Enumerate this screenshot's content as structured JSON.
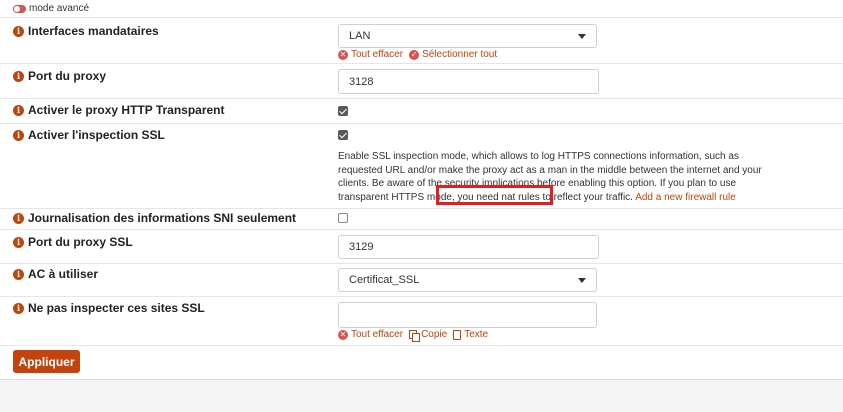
{
  "mode_toggle": {
    "label": "mode avancé"
  },
  "fields": {
    "interfaces": {
      "label": "Interfaces mandataires",
      "value": "LAN",
      "clear_all": "Tout effacer",
      "select_all": "Sélectionner tout"
    },
    "proxy_port": {
      "label": "Port du proxy",
      "value": "3128"
    },
    "transparent": {
      "label": "Activer le proxy HTTP Transparent",
      "checked": true
    },
    "ssl_inspection": {
      "label": "Activer l'inspection SSL",
      "checked": true,
      "help_text": "Enable SSL inspection mode, which allows to log HTTPS connections information, such as requested URL and/or make the proxy act as a man in the middle between the internet and your clients. Be aware of the security implications before enabling this option. If you plan to use transparent HTTPS mode, you need nat rules to reflect your traffic.",
      "help_link": "Add a new firewall rule"
    },
    "sni_logging": {
      "label": "Journalisation des informations SNI seulement",
      "checked": false
    },
    "ssl_port": {
      "label": "Port du proxy SSL",
      "value": "3129"
    },
    "ca": {
      "label": "AC à utiliser",
      "value": "Certificat_SSL"
    },
    "no_inspect": {
      "label": "Ne pas inspecter ces sites SSL",
      "value": "",
      "clear_all": "Tout effacer",
      "copy": "Copie",
      "text": "Texte"
    }
  },
  "apply_button": "Appliquer",
  "colors": {
    "accent": "#c1440e",
    "highlight": "#e02020"
  }
}
